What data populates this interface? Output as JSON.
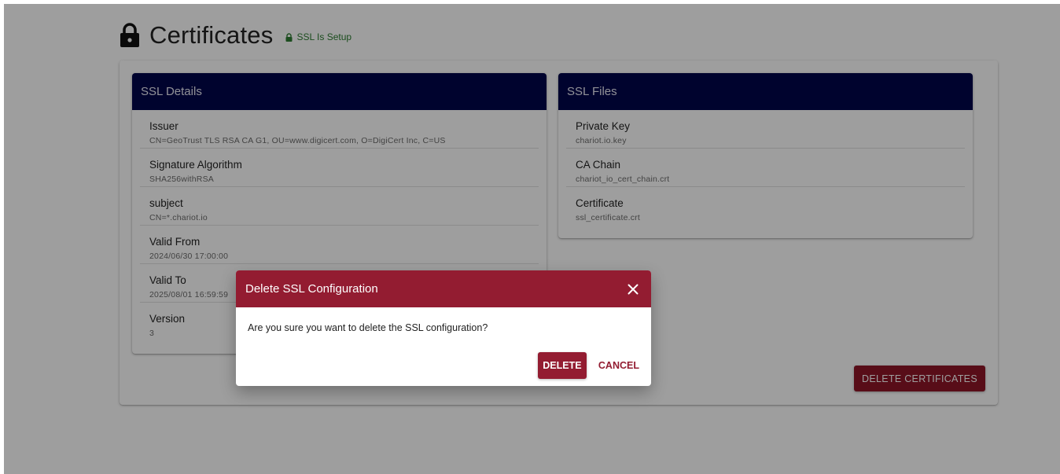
{
  "header": {
    "title": "Certificates",
    "ssl_status": "SSL Is Setup",
    "ssl_status_color": "#2e7d32"
  },
  "ssl_details": {
    "title": "SSL Details",
    "items": [
      {
        "label": "Issuer",
        "value": "CN=GeoTrust TLS RSA CA G1, OU=www.digicert.com, O=DigiCert Inc, C=US"
      },
      {
        "label": "Signature Algorithm",
        "value": "SHA256withRSA"
      },
      {
        "label": "subject",
        "value": "CN=*.chariot.io"
      },
      {
        "label": "Valid From",
        "value": "2024/06/30 17:00:00"
      },
      {
        "label": "Valid To",
        "value": "2025/08/01 16:59:59"
      },
      {
        "label": "Version",
        "value": "3"
      }
    ]
  },
  "ssl_files": {
    "title": "SSL Files",
    "items": [
      {
        "label": "Private Key",
        "value": "chariot.io.key"
      },
      {
        "label": "CA Chain",
        "value": "chariot_io_cert_chain.crt"
      },
      {
        "label": "Certificate",
        "value": "ssl_certificate.crt"
      }
    ]
  },
  "actions": {
    "delete_certificates_label": "DELETE CERTIFICATES"
  },
  "dialog": {
    "title": "Delete SSL Configuration",
    "message": "Are you sure you want to delete the SSL configuration?",
    "delete_label": "DELETE",
    "cancel_label": "CANCEL",
    "close_icon": "close-icon"
  },
  "colors": {
    "panel_header": "#00064b",
    "danger": "#931c31"
  }
}
